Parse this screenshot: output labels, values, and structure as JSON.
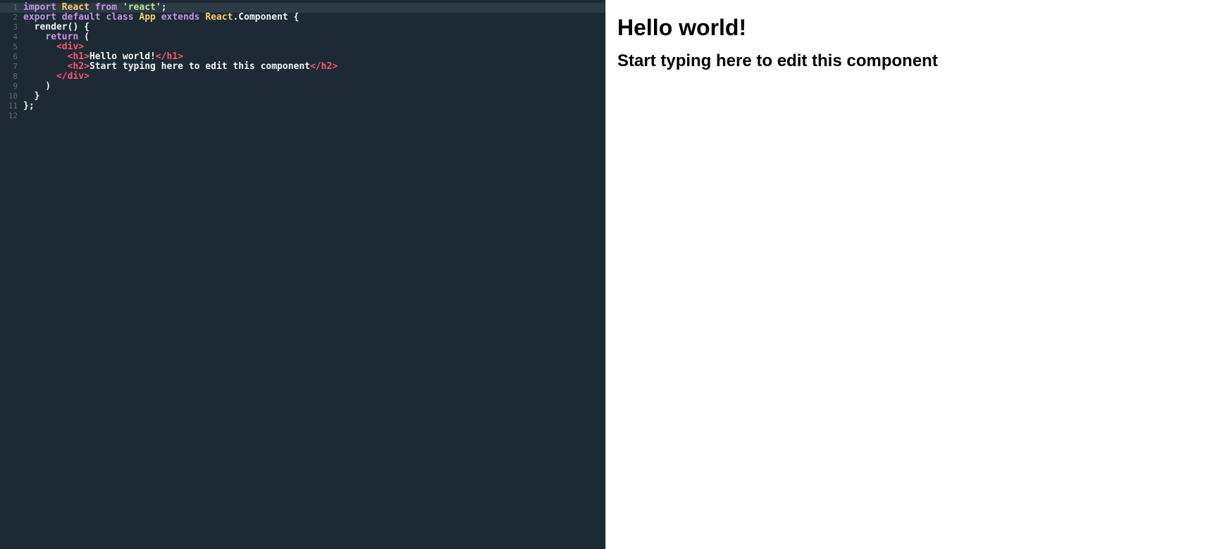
{
  "editor": {
    "lines": [
      {
        "number": "1",
        "tokens": [
          {
            "t": "keyword",
            "v": "import"
          },
          {
            "t": "plain",
            "v": " "
          },
          {
            "t": "ident",
            "v": "React"
          },
          {
            "t": "plain",
            "v": " "
          },
          {
            "t": "keyword",
            "v": "from"
          },
          {
            "t": "plain",
            "v": " "
          },
          {
            "t": "string",
            "v": "'react'"
          },
          {
            "t": "punct",
            "v": ";"
          }
        ]
      },
      {
        "number": "2",
        "tokens": [
          {
            "t": "keyword",
            "v": "export"
          },
          {
            "t": "plain",
            "v": " "
          },
          {
            "t": "keyword",
            "v": "default"
          },
          {
            "t": "plain",
            "v": " "
          },
          {
            "t": "keyword",
            "v": "class"
          },
          {
            "t": "plain",
            "v": " "
          },
          {
            "t": "ident",
            "v": "App"
          },
          {
            "t": "plain",
            "v": " "
          },
          {
            "t": "keyword",
            "v": "extends"
          },
          {
            "t": "plain",
            "v": " "
          },
          {
            "t": "ident",
            "v": "React"
          },
          {
            "t": "plain",
            "v": ".Component {"
          }
        ]
      },
      {
        "number": "3",
        "tokens": [
          {
            "t": "plain",
            "v": "  render() {"
          }
        ]
      },
      {
        "number": "4",
        "tokens": [
          {
            "t": "plain",
            "v": "    "
          },
          {
            "t": "keyword",
            "v": "return"
          },
          {
            "t": "plain",
            "v": " ("
          }
        ]
      },
      {
        "number": "5",
        "tokens": [
          {
            "t": "plain",
            "v": "      "
          },
          {
            "t": "tag",
            "v": "<div>"
          }
        ]
      },
      {
        "number": "6",
        "tokens": [
          {
            "t": "plain",
            "v": "        "
          },
          {
            "t": "tag",
            "v": "<h1>"
          },
          {
            "t": "plain",
            "v": "Hello world!"
          },
          {
            "t": "tag",
            "v": "</h1>"
          }
        ]
      },
      {
        "number": "7",
        "tokens": [
          {
            "t": "plain",
            "v": "        "
          },
          {
            "t": "tag",
            "v": "<h2>"
          },
          {
            "t": "plain",
            "v": "Start typing here to edit this component"
          },
          {
            "t": "tag",
            "v": "</h2>"
          }
        ]
      },
      {
        "number": "8",
        "tokens": [
          {
            "t": "plain",
            "v": "      "
          },
          {
            "t": "tag",
            "v": "</div>"
          }
        ]
      },
      {
        "number": "9",
        "tokens": [
          {
            "t": "plain",
            "v": "    )"
          }
        ]
      },
      {
        "number": "10",
        "tokens": [
          {
            "t": "plain",
            "v": "  }"
          }
        ]
      },
      {
        "number": "11",
        "tokens": [
          {
            "t": "plain",
            "v": "};"
          }
        ]
      },
      {
        "number": "12",
        "tokens": []
      }
    ],
    "active_line": 1,
    "colors": {
      "background": "#1c2b33",
      "keyword": "#c792ea",
      "identifier": "#ffcb6b",
      "string": "#c3e88d",
      "tag": "#ff5370",
      "text": "#f2f4f5",
      "line_number": "#5c6b75"
    }
  },
  "preview": {
    "heading": "Hello world!",
    "subheading": "Start typing here to edit this component"
  }
}
